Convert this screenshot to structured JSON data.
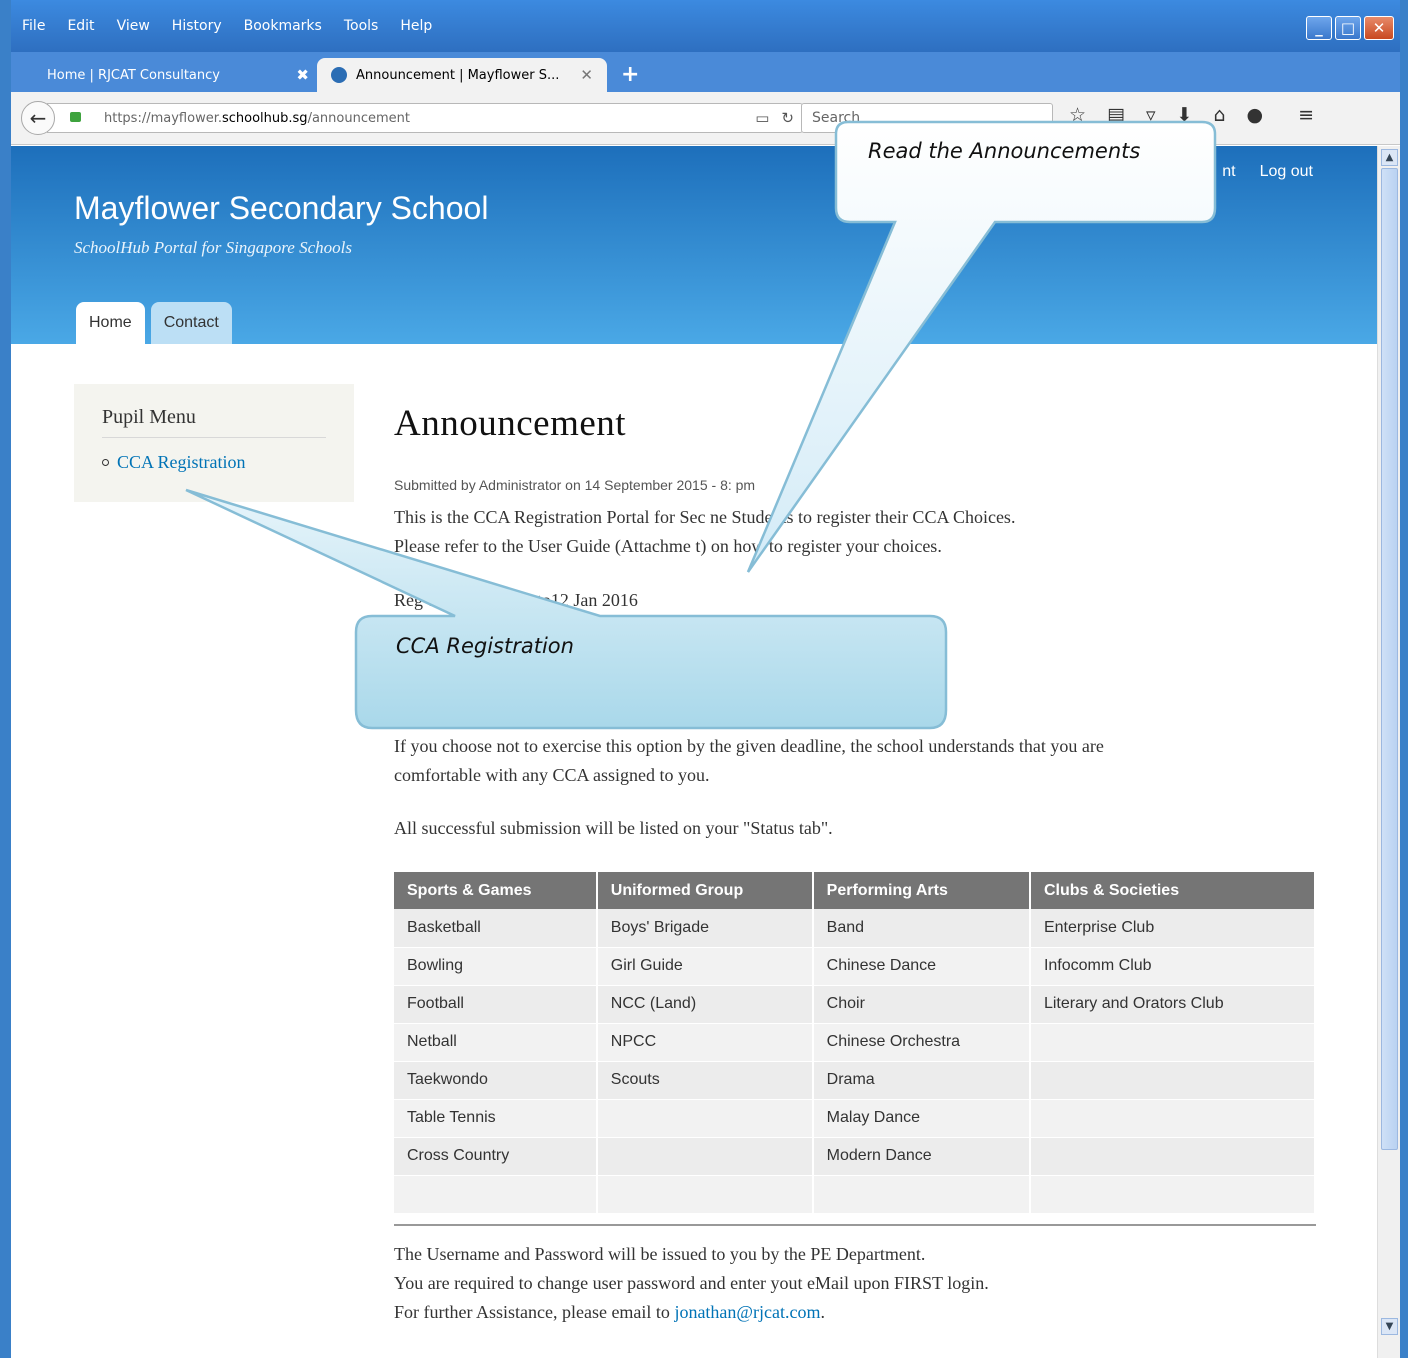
{
  "browser": {
    "menu": [
      "File",
      "Edit",
      "View",
      "History",
      "Bookmarks",
      "Tools",
      "Help"
    ],
    "tabs": [
      {
        "label": "Home | RJCAT Consultancy",
        "active": false
      },
      {
        "label": "Announcement | Mayflower S...",
        "active": true
      }
    ],
    "url_prefix": "https://mayflower.",
    "url_domain": "schoolhub.sg",
    "url_path": "/announcement",
    "search_placeholder": "Search"
  },
  "site": {
    "name": "Mayflower Secondary School",
    "slogan": "SchoolHub Portal for Singapore Schools",
    "secondary_menu": [
      "nt",
      "Log out"
    ],
    "main_tabs": [
      "Home",
      "Contact"
    ]
  },
  "sidebar": {
    "title": "Pupil Menu",
    "items": [
      "CCA Registration"
    ]
  },
  "content": {
    "title": "Announcement",
    "submitted": "Submitted by Administrator on 14 September 2015 - 8:  pm",
    "p1_line1": "This is the CCA Registration Portal for Sec  ne Students to register their CCA Choices.",
    "p1_line2": "Please refer to the User Guide (Attachme  t) on how to register your choices.",
    "p2": "Reg          d: 11 Jan 2016 to12 Jan 2016",
    "p3_line1": "If you choose not to exercise this option by the given deadline, the school understands that you are",
    "p3_line2": "comfortable with any CCA assigned to you.",
    "p4": "All successful submission will be listed on your \"Status tab\".",
    "table": {
      "headers": [
        "Sports & Games",
        "Uniformed Group",
        "Performing Arts",
        "Clubs & Societies"
      ],
      "rows": [
        [
          "Basketball",
          "Boys' Brigade",
          "Band",
          "Enterprise Club"
        ],
        [
          "Bowling",
          "Girl Guide",
          "Chinese Dance",
          "Infocomm Club"
        ],
        [
          "Football",
          "NCC (Land)",
          "Choir",
          "Literary and Orators Club"
        ],
        [
          "Netball",
          "NPCC",
          "Chinese Orchestra",
          ""
        ],
        [
          "Taekwondo",
          "Scouts",
          "Drama",
          ""
        ],
        [
          "Table Tennis",
          "",
          "Malay Dance",
          ""
        ],
        [
          "Cross Country",
          "",
          "Modern Dance",
          ""
        ],
        [
          "",
          "",
          "",
          ""
        ]
      ]
    },
    "footer_line1": "The Username and Password will be issued to you by the PE Department.",
    "footer_line2": "You are required to change user password and enter yout eMail upon FIRST login.",
    "footer_line3_prefix": "For further Assistance, please email to ",
    "footer_email": "jonathan@rjcat.com",
    "footer_line3_suffix": "."
  },
  "callouts": {
    "announcements": "Read the Announcements",
    "cca": "CCA Registration"
  }
}
